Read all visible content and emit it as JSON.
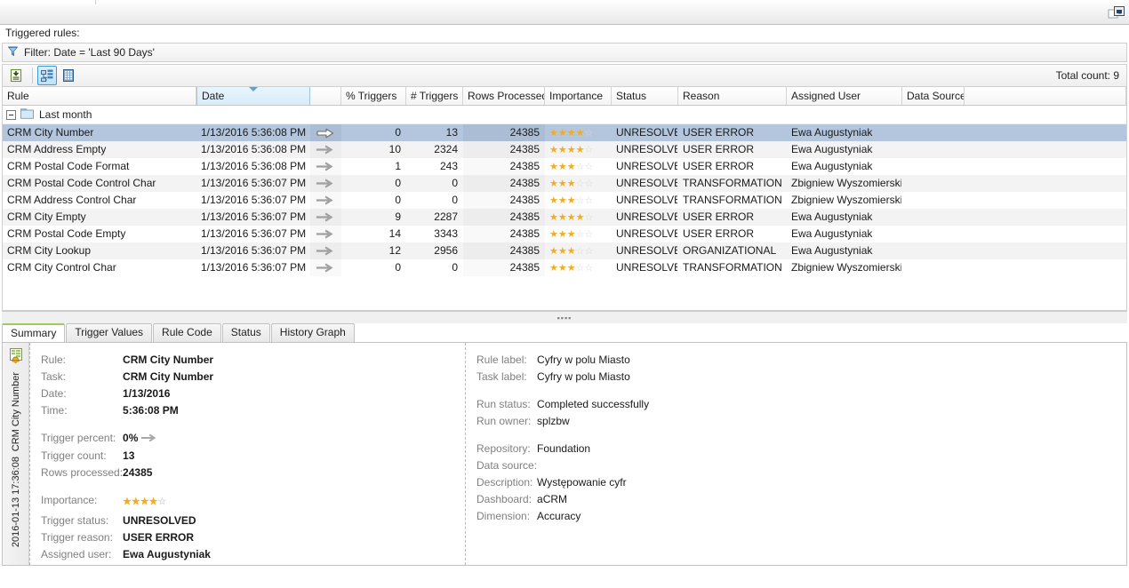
{
  "window": {
    "restore_icon": "restore-window-icon"
  },
  "header": {
    "triggered_rules_label": "Triggered rules:",
    "filter_text": "Filter: Date = 'Last 90 Days'",
    "filter_icon": "funnel-filter-icon",
    "total_count": "Total count: 9"
  },
  "toolbar": {
    "buttons": [
      {
        "name": "export-list-icon",
        "pressed": false
      },
      {
        "name": "tree-view-icon",
        "pressed": true
      },
      {
        "name": "grid-view-icon",
        "pressed": false
      }
    ]
  },
  "grid": {
    "columns": [
      {
        "key": "rule",
        "label": "Rule",
        "sorted": false
      },
      {
        "key": "date",
        "label": "Date",
        "sorted": true
      },
      {
        "key": "arrow",
        "label": "",
        "sorted": false
      },
      {
        "key": "pct",
        "label": "% Triggers",
        "sorted": false
      },
      {
        "key": "cnt",
        "label": "# Triggers",
        "sorted": false
      },
      {
        "key": "rows",
        "label": "Rows Processed",
        "sorted": false
      },
      {
        "key": "imp",
        "label": "Importance",
        "sorted": false
      },
      {
        "key": "status",
        "label": "Status",
        "sorted": false
      },
      {
        "key": "reason",
        "label": "Reason",
        "sorted": false
      },
      {
        "key": "user",
        "label": "Assigned User",
        "sorted": false
      },
      {
        "key": "source",
        "label": "Data Source",
        "sorted": false
      },
      {
        "key": "last",
        "label": "",
        "sorted": false
      }
    ],
    "group_label": "Last month",
    "group_icon": "folder-icon",
    "rows": [
      {
        "rule": "CRM City Number",
        "date": "1/13/2016 5:36:08 PM",
        "arrow": "arrow-outline-icon",
        "pct": "0",
        "cnt": "13",
        "rows": "24385",
        "stars": 4,
        "status": "UNRESOLVED",
        "reason": "USER ERROR",
        "user": "Ewa Augustyniak",
        "source": "",
        "selected": true
      },
      {
        "rule": "CRM Address Empty",
        "date": "1/13/2016 5:36:08 PM",
        "arrow": "arrow-icon",
        "pct": "10",
        "cnt": "2324",
        "rows": "24385",
        "stars": 4,
        "status": "UNRESOLVED",
        "reason": "USER ERROR",
        "user": "Ewa Augustyniak",
        "source": "",
        "selected": false
      },
      {
        "rule": "CRM Postal Code Format",
        "date": "1/13/2016 5:36:08 PM",
        "arrow": "arrow-icon",
        "pct": "1",
        "cnt": "243",
        "rows": "24385",
        "stars": 3,
        "status": "UNRESOLVED",
        "reason": "USER ERROR",
        "user": "Ewa Augustyniak",
        "source": "",
        "selected": false
      },
      {
        "rule": "CRM Postal Code Control Char",
        "date": "1/13/2016 5:36:07 PM",
        "arrow": "arrow-icon",
        "pct": "0",
        "cnt": "0",
        "rows": "24385",
        "stars": 3,
        "status": "UNRESOLVED",
        "reason": "TRANSFORMATION",
        "user": "Zbigniew Wyszomierski",
        "source": "",
        "selected": false
      },
      {
        "rule": "CRM Address Control Char",
        "date": "1/13/2016 5:36:07 PM",
        "arrow": "arrow-icon",
        "pct": "0",
        "cnt": "0",
        "rows": "24385",
        "stars": 3,
        "status": "UNRESOLVED",
        "reason": "TRANSFORMATION",
        "user": "Zbigniew Wyszomierski",
        "source": "",
        "selected": false
      },
      {
        "rule": "CRM City Empty",
        "date": "1/13/2016 5:36:07 PM",
        "arrow": "arrow-icon",
        "pct": "9",
        "cnt": "2287",
        "rows": "24385",
        "stars": 4,
        "status": "UNRESOLVED",
        "reason": "USER ERROR",
        "user": "Ewa Augustyniak",
        "source": "",
        "selected": false
      },
      {
        "rule": "CRM Postal Code Empty",
        "date": "1/13/2016 5:36:07 PM",
        "arrow": "arrow-icon",
        "pct": "14",
        "cnt": "3343",
        "rows": "24385",
        "stars": 3,
        "status": "UNRESOLVED",
        "reason": "USER ERROR",
        "user": "Ewa Augustyniak",
        "source": "",
        "selected": false
      },
      {
        "rule": "CRM City Lookup",
        "date": "1/13/2016 5:36:07 PM",
        "arrow": "arrow-icon",
        "pct": "12",
        "cnt": "2956",
        "rows": "24385",
        "stars": 3,
        "status": "UNRESOLVED",
        "reason": "ORGANIZATIONAL",
        "user": "Ewa Augustyniak",
        "source": "",
        "selected": false
      },
      {
        "rule": "CRM City Control Char",
        "date": "1/13/2016 5:36:07 PM",
        "arrow": "arrow-icon",
        "pct": "0",
        "cnt": "0",
        "rows": "24385",
        "stars": 3,
        "status": "UNRESOLVED",
        "reason": "TRANSFORMATION",
        "user": "Zbigniew Wyszomierski",
        "source": "",
        "selected": false
      }
    ]
  },
  "tabs": [
    {
      "label": "Summary",
      "active": true
    },
    {
      "label": "Trigger Values",
      "active": false
    },
    {
      "label": "Rule Code",
      "active": false
    },
    {
      "label": "Status",
      "active": false
    },
    {
      "label": "History Graph",
      "active": false
    }
  ],
  "detail": {
    "vstrip": {
      "icon": "alert-table-icon",
      "title": "CRM City Number",
      "timestamp": "2016-01-13 17:36:08"
    },
    "left": {
      "rule_label": "Rule:",
      "rule_value": "CRM City Number",
      "task_label": "Task:",
      "task_value": "CRM City Number",
      "date_label": "Date:",
      "date_value": "1/13/2016",
      "time_label": "Time:",
      "time_value": "5:36:08 PM",
      "trigger_percent_label": "Trigger percent:",
      "trigger_percent_value": "0%",
      "trigger_percent_icon": "arrow-icon",
      "trigger_count_label": "Trigger count:",
      "trigger_count_value": "13",
      "rows_processed_label": "Rows processed:",
      "rows_processed_value": "24385",
      "importance_label": "Importance:",
      "importance_stars": 4,
      "trigger_status_label": "Trigger status:",
      "trigger_status_value": "UNRESOLVED",
      "trigger_reason_label": "Trigger reason:",
      "trigger_reason_value": "USER ERROR",
      "assigned_user_label": "Assigned user:",
      "assigned_user_value": "Ewa Augustyniak"
    },
    "right": {
      "rule_label_label": "Rule label:",
      "rule_label_value": "Cyfry w polu Miasto",
      "task_label_label": "Task label:",
      "task_label_value": "Cyfry w polu Miasto",
      "run_status_label": "Run status:",
      "run_status_value": "Completed successfully",
      "run_owner_label": "Run owner:",
      "run_owner_value": "splzbw",
      "repository_label": "Repository:",
      "repository_value": "Foundation",
      "data_source_label": "Data source:",
      "data_source_value": "",
      "description_label": "Description:",
      "description_value": "Występowanie cyfr",
      "dashboard_label": "Dashboard:",
      "dashboard_value": "aCRM",
      "dimension_label": "Dimension:",
      "dimension_value": "Accuracy"
    }
  },
  "colors": {
    "selection": "#b3c6de",
    "star_on": "#f0ad21",
    "star_off": "#d9d9d9",
    "active_tab_accent": "#9acd5a",
    "sorted_column": "#d6ecf8"
  }
}
